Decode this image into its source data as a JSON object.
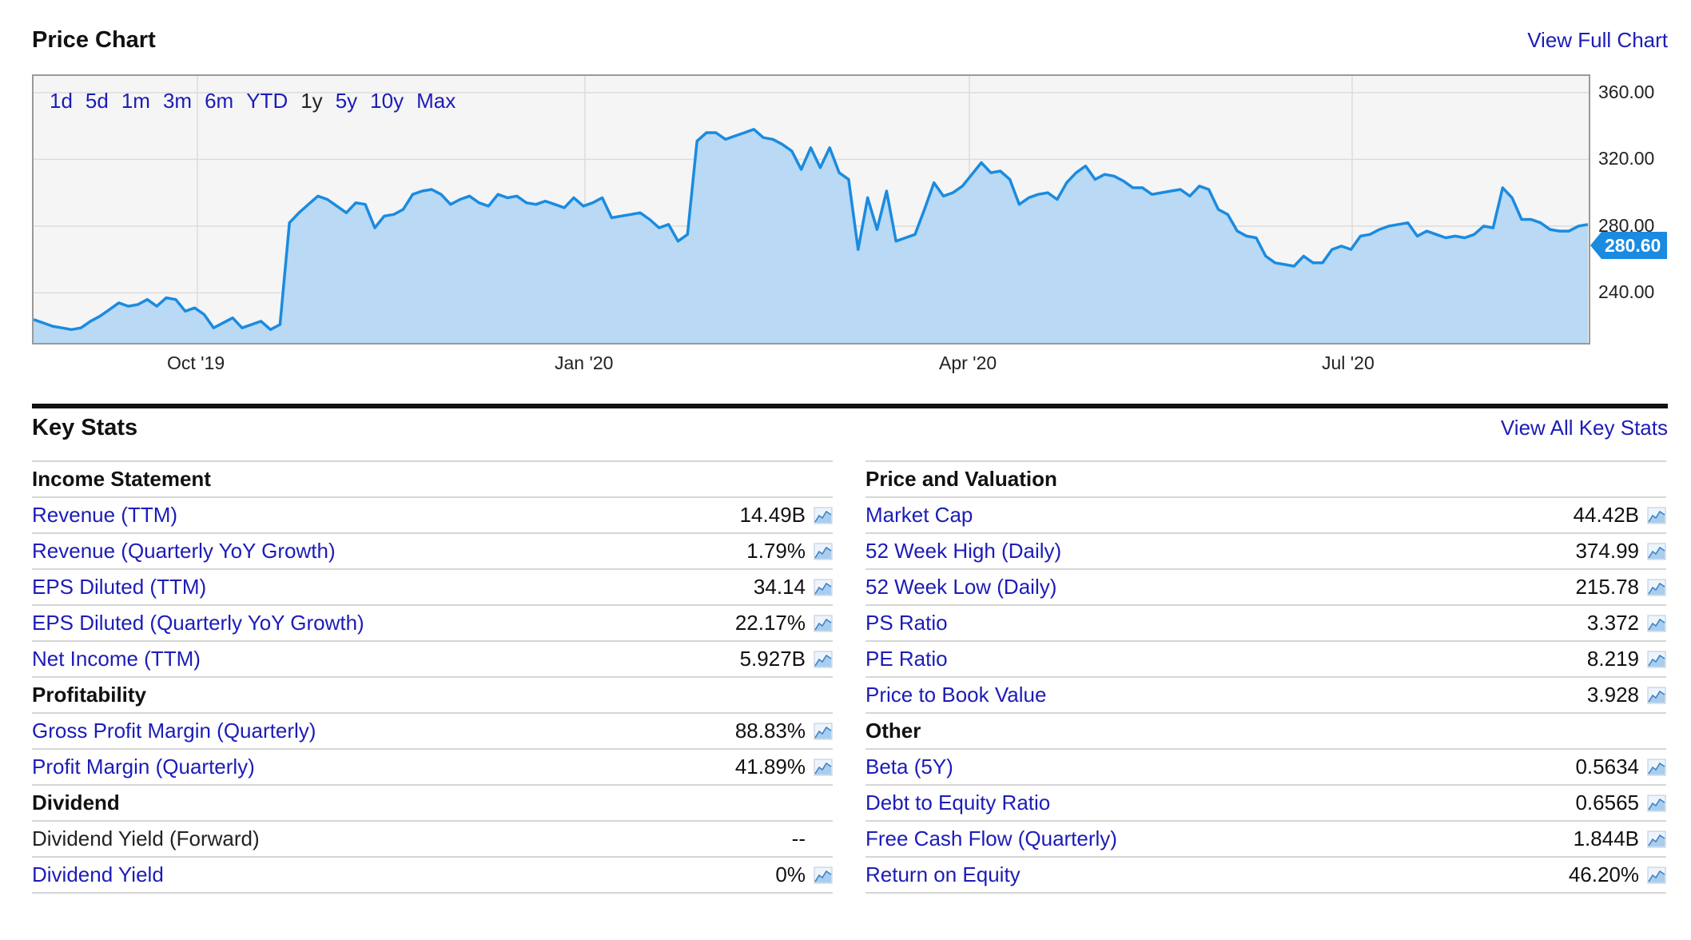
{
  "price_chart": {
    "title": "Price Chart",
    "view_full_link": "View Full Chart",
    "ranges": [
      "1d",
      "5d",
      "1m",
      "3m",
      "6m",
      "YTD",
      "1y",
      "5y",
      "10y",
      "Max"
    ],
    "active_range": "1y",
    "current_price_label": "280.60"
  },
  "chart_data": {
    "type": "area",
    "x_ticks": [
      "Oct '19",
      "Jan '20",
      "Apr '20",
      "Jul '20"
    ],
    "y_ticks": [
      "240.00",
      "280.00",
      "320.00",
      "360.00"
    ],
    "ylim": [
      210,
      370
    ],
    "grid": true,
    "colors": {
      "line": "#1a8be0",
      "fill": "#b9d9f4"
    },
    "series": [
      {
        "values": [
          224,
          222,
          220,
          219,
          218,
          219,
          223,
          226,
          230,
          234,
          232,
          233,
          236,
          232,
          237,
          236,
          229,
          231,
          227,
          219,
          222,
          225,
          219,
          221,
          223,
          218,
          221,
          282,
          288,
          293,
          298,
          296,
          292,
          288,
          294,
          293,
          279,
          286,
          287,
          290,
          299,
          301,
          302,
          299,
          293,
          296,
          298,
          294,
          292,
          299,
          297,
          298,
          294,
          293,
          295,
          293,
          291,
          297,
          292,
          294,
          297,
          285,
          286,
          287,
          288,
          284,
          279,
          281,
          271,
          275,
          331,
          336,
          336,
          332,
          334,
          336,
          338,
          333,
          332,
          329,
          325,
          314,
          327,
          315,
          327,
          312,
          308,
          266,
          297,
          278,
          301,
          271,
          273,
          275,
          290,
          306,
          298,
          300,
          304,
          311,
          318,
          312,
          313,
          308,
          293,
          297,
          299,
          300,
          296,
          306,
          312,
          316,
          308,
          311,
          310,
          307,
          303,
          303,
          299,
          300,
          301,
          302,
          298,
          304,
          302,
          290,
          287,
          277,
          274,
          273,
          262,
          258,
          257,
          256,
          262,
          258,
          258,
          266,
          268,
          266,
          274,
          275,
          278,
          280,
          281,
          282,
          274,
          277,
          275,
          273,
          274,
          273,
          275,
          280,
          279,
          303,
          297,
          284,
          284,
          282,
          278,
          277,
          277,
          280,
          281
        ]
      }
    ]
  },
  "key_stats": {
    "title": "Key Stats",
    "view_all_link": "View All Key Stats",
    "left": [
      {
        "group": "Income Statement"
      },
      {
        "label": "Revenue (TTM)",
        "value": "14.49B",
        "link": true,
        "spark": true
      },
      {
        "label": "Revenue (Quarterly YoY Growth)",
        "value": "1.79%",
        "link": true,
        "spark": true
      },
      {
        "label": "EPS Diluted (TTM)",
        "value": "34.14",
        "link": true,
        "spark": true
      },
      {
        "label": "EPS Diluted (Quarterly YoY Growth)",
        "value": "22.17%",
        "link": true,
        "spark": true
      },
      {
        "label": "Net Income (TTM)",
        "value": "5.927B",
        "link": true,
        "spark": true
      },
      {
        "group": "Profitability"
      },
      {
        "label": "Gross Profit Margin (Quarterly)",
        "value": "88.83%",
        "link": true,
        "spark": true
      },
      {
        "label": "Profit Margin (Quarterly)",
        "value": "41.89%",
        "link": true,
        "spark": true
      },
      {
        "group": "Dividend"
      },
      {
        "label": "Dividend Yield (Forward)",
        "value": "--",
        "link": false,
        "spark": false
      },
      {
        "label": "Dividend Yield",
        "value": "0%",
        "link": true,
        "spark": true
      }
    ],
    "right": [
      {
        "group": "Price and Valuation"
      },
      {
        "label": "Market Cap",
        "value": "44.42B",
        "link": true,
        "spark": true
      },
      {
        "label": "52 Week High (Daily)",
        "value": "374.99",
        "link": true,
        "spark": true
      },
      {
        "label": "52 Week Low (Daily)",
        "value": "215.78",
        "link": true,
        "spark": true
      },
      {
        "label": "PS Ratio",
        "value": "3.372",
        "link": true,
        "spark": true
      },
      {
        "label": "PE Ratio",
        "value": "8.219",
        "link": true,
        "spark": true
      },
      {
        "label": "Price to Book Value",
        "value": "3.928",
        "link": true,
        "spark": true
      },
      {
        "group": "Other"
      },
      {
        "label": "Beta (5Y)",
        "value": "0.5634",
        "link": true,
        "spark": true
      },
      {
        "label": "Debt to Equity Ratio",
        "value": "0.6565",
        "link": true,
        "spark": true
      },
      {
        "label": "Free Cash Flow (Quarterly)",
        "value": "1.844B",
        "link": true,
        "spark": true
      },
      {
        "label": "Return on Equity",
        "value": "46.20%",
        "link": true,
        "spark": true
      }
    ]
  }
}
